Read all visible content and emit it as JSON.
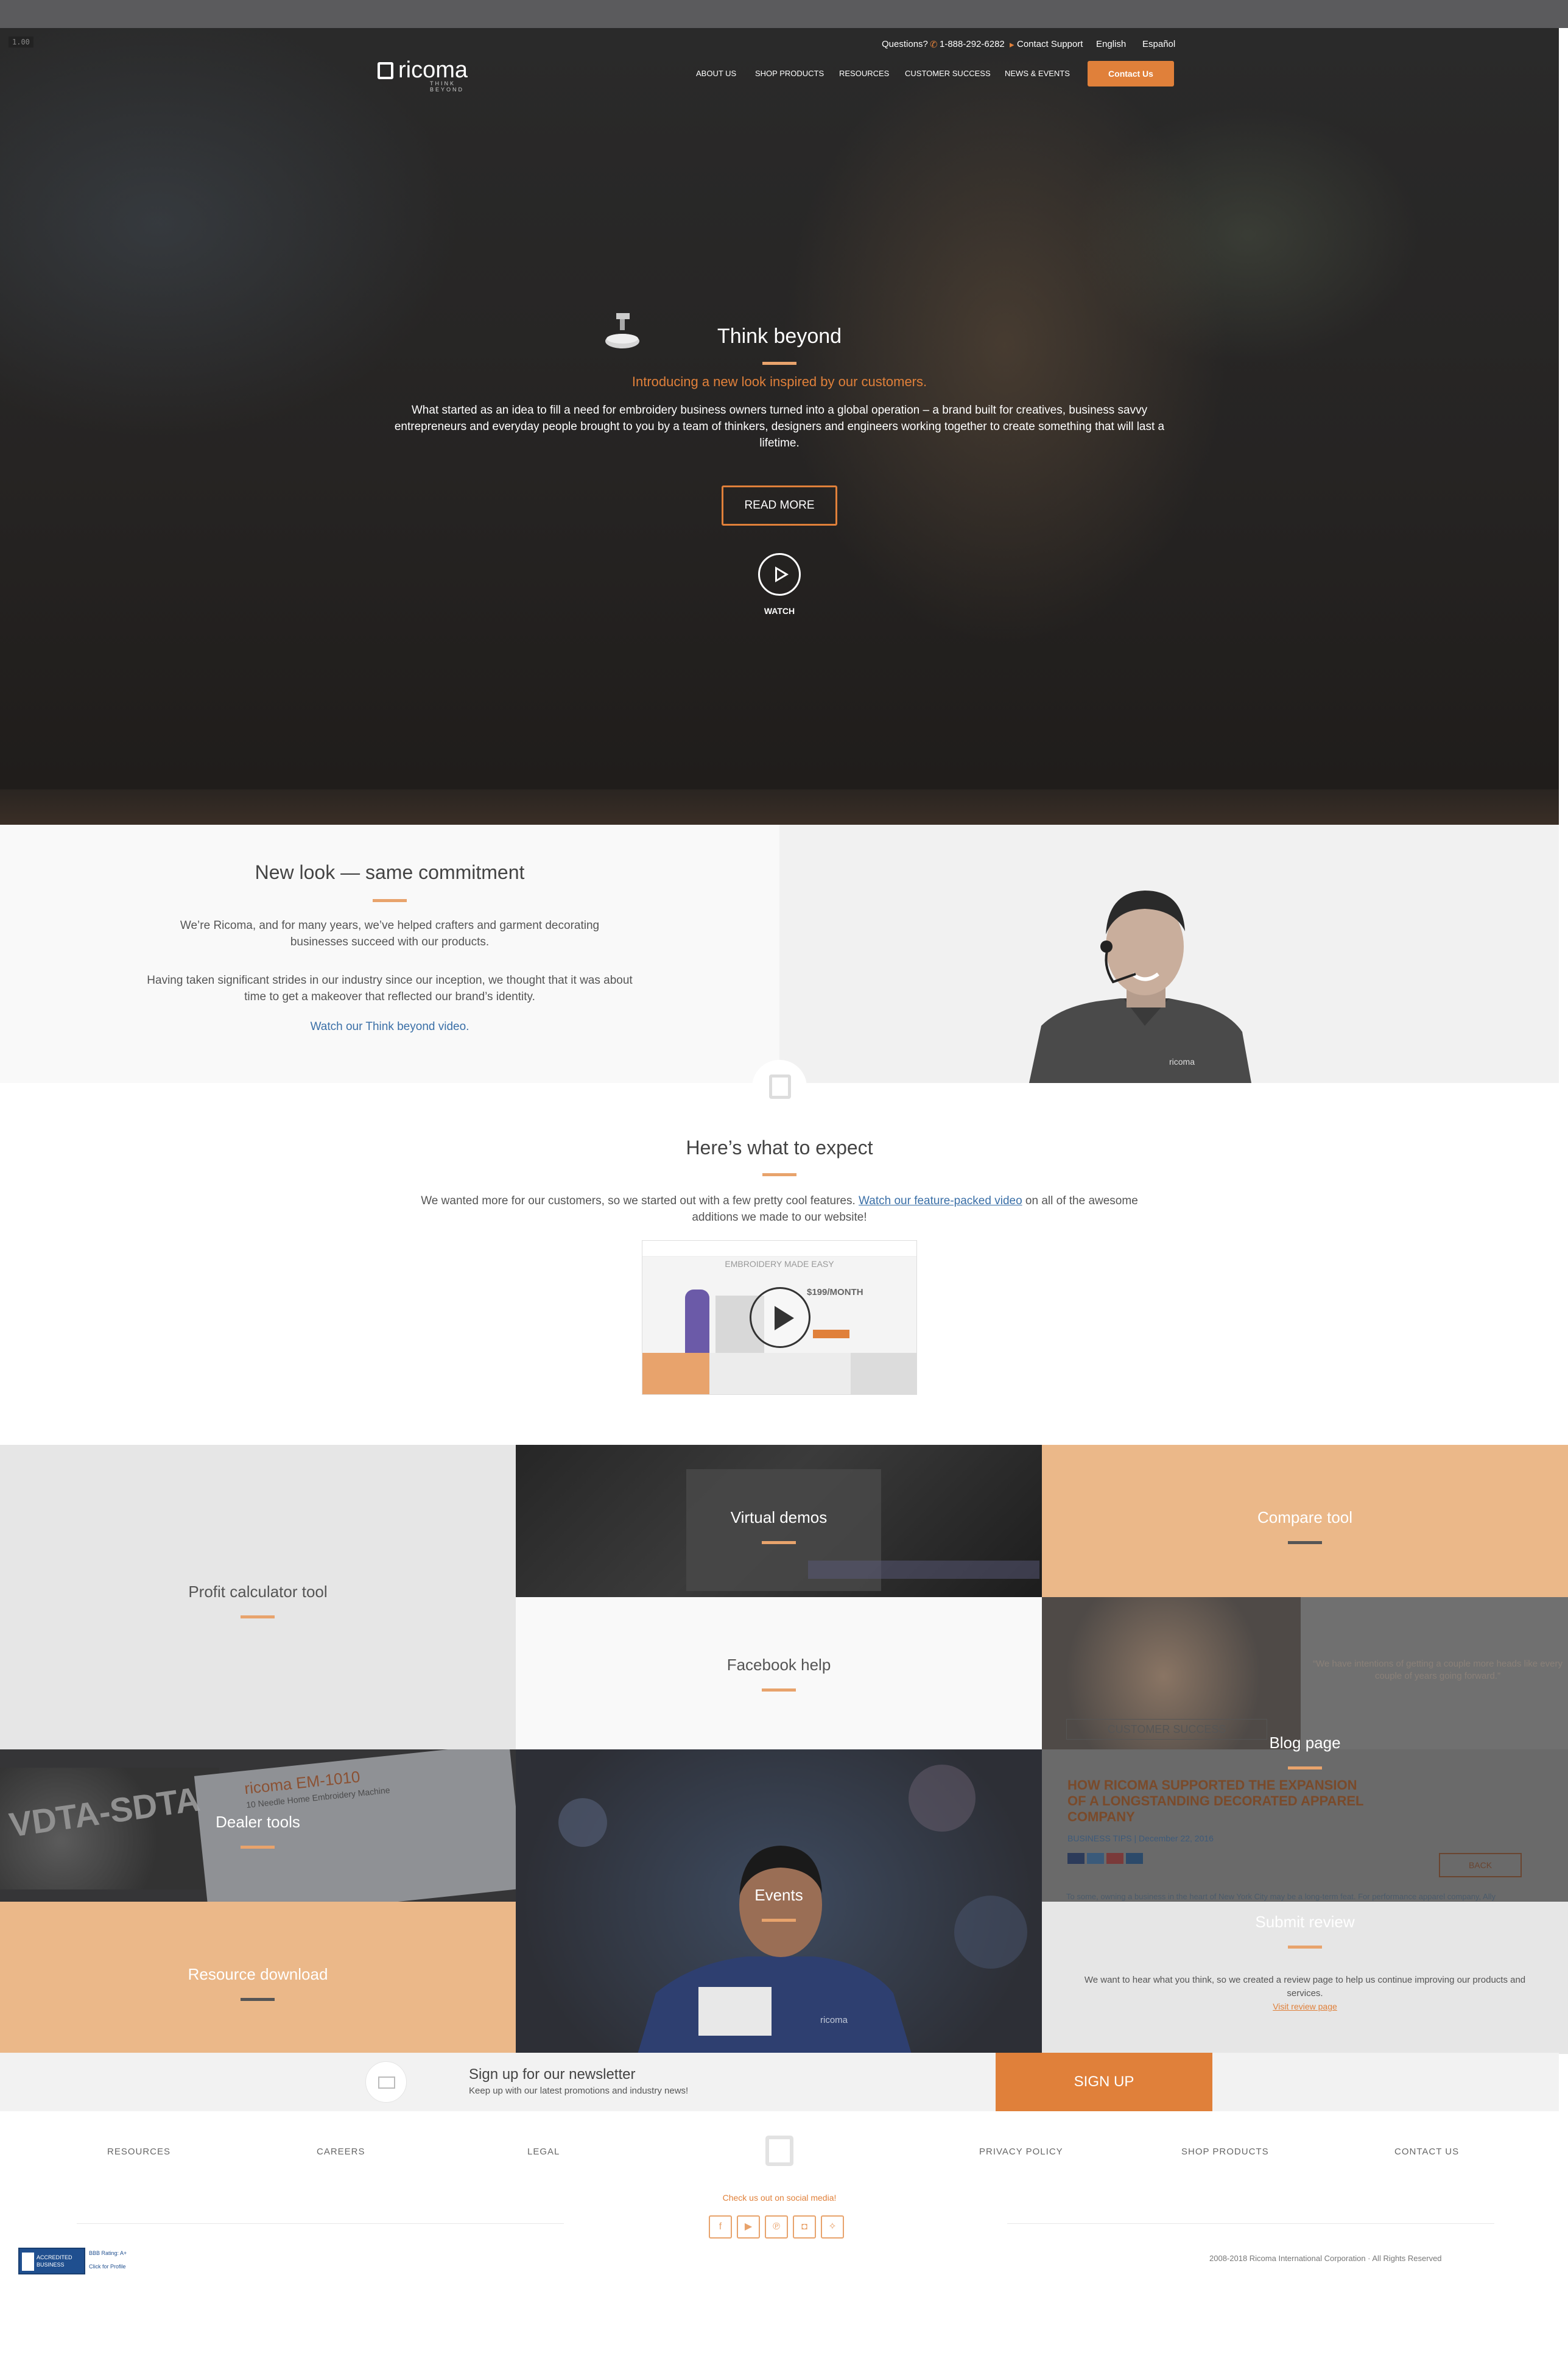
{
  "topbar": {
    "version_label": "1.00"
  },
  "utility": {
    "questions": "Questions?",
    "phone": "1-888-292-6282",
    "support": "Contact Support",
    "english": "English",
    "espanol": "Español"
  },
  "brand": {
    "wordmark": "ricoma",
    "tagline": "THINK BEYOND"
  },
  "nav": {
    "items": [
      "ABOUT US",
      "SHOP PRODUCTS",
      "RESOURCES",
      "CUSTOMER SUCCESS",
      "NEWS & EVENTS"
    ],
    "contact_label": "Contact Us"
  },
  "hero": {
    "title": "Think beyond",
    "subtitle": "Introducing a new look inspired by our customers.",
    "body": "What started as an idea to fill a need for embroidery business owners turned into a global operation – a brand built for creatives, business savvy entrepreneurs and everyday people brought to you by a team of thinkers, designers and engineers working together to create something that will last a lifetime.",
    "read_more": "READ MORE",
    "watch": "WATCH"
  },
  "commitment": {
    "title": "New look — same commitment",
    "intro": "We’re Ricoma, and for many years, we’ve helped crafters and garment decorating businesses succeed with our products.",
    "body": "Having taken significant strides in our industry since our inception, we thought that it was about time to get a makeover that reflected our brand’s identity.",
    "link": "Watch our Think beyond video."
  },
  "expect": {
    "title": "Here’s what to expect",
    "body_before": "We wanted more for our customers, so we started out with a few pretty cool features.",
    "link": "Watch our feature-packed video",
    "body_after": "on all of the awesome additions we made to our website!",
    "thumb_headline": "EMBROIDERY MADE EASY",
    "thumb_price": "$199/MONTH"
  },
  "tiles": {
    "profit": "Profit calculator tool",
    "virtual": "Virtual demos",
    "compare": "Compare tool",
    "facebook": "Facebook help",
    "blog": "Blog page",
    "blog_quote": "“We have intentions of getting a couple more heads like every couple of years going forward.”",
    "blog_tag": "CUSTOMER SUCCESS",
    "blog_headline": "HOW RICOMA SUPPORTED THE EXPANSION OF A LONGSTANDING DECORATED APPAREL COMPANY",
    "blog_meta": "BUSINESS TIPS | December 22, 2016",
    "blog_back": "BACK",
    "blog_excerpt": "To some, owning a business in the heart of New York City may be a long-term feat. For performance apparel company, Ally",
    "dealer": "Dealer tools",
    "dealer_sign": "VDTA-SDTA",
    "dealer_brochure_brand": "ricoma EM-1010",
    "dealer_brochure_sub": "10 Needle Home Embroidery Machine",
    "events": "Events",
    "events_shirt": "ricoma",
    "resource": "Resource download",
    "review": "Submit review",
    "review_body": "We want to hear what you think, so we created a review page to help us continue improving our products and services.",
    "review_link": "Visit review page"
  },
  "newsletter": {
    "title": "Sign up for our newsletter",
    "sub": "Keep up with our latest promotions and industry news!",
    "button": "SIGN UP"
  },
  "footer": {
    "links_left": [
      "RESOURCES",
      "CAREERS",
      "LEGAL"
    ],
    "links_right": [
      "PRIVACY POLICY",
      "SHOP PRODUCTS",
      "CONTACT US"
    ],
    "social_title": "Check us out on social media!",
    "social_icons": [
      "facebook-icon",
      "youtube-icon",
      "pinterest-icon",
      "instagram-icon",
      "twitter-icon"
    ],
    "copyright": "2008-2018 Ricoma International Corporation · All Rights Reserved",
    "bbb_label": "ACCREDITED BUSINESS",
    "bbb_rating": "BBB Rating: A+",
    "bbb_click": "Click for Profile"
  },
  "colors": {
    "accent": "#e0803a",
    "accent_light": "#e8a36c",
    "link": "#3a6fa7"
  }
}
